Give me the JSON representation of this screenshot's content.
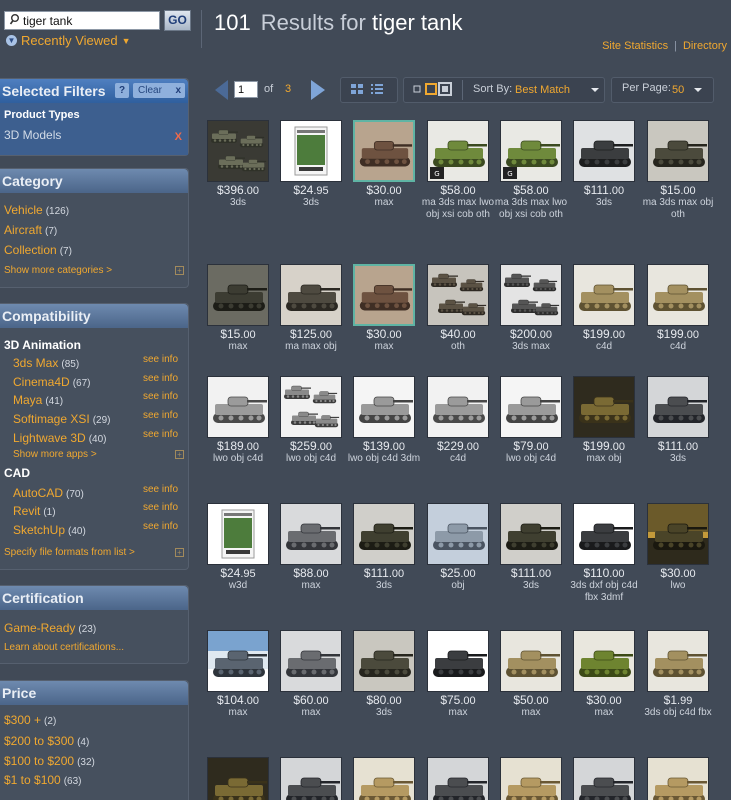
{
  "search": {
    "value": "tiger tank",
    "go_label": "GO"
  },
  "recently_viewed": "Recently Viewed",
  "header": {
    "count": "101",
    "results_for": "Results for",
    "query": "tiger tank"
  },
  "toplinks": {
    "site_statistics": "Site Statistics",
    "separator": "|",
    "directory": "Directory"
  },
  "selected_filters": {
    "title": "Selected Filters",
    "help": "?",
    "clear": "Clear",
    "clear_x": "x",
    "label": "Product Types",
    "value": "3D Models",
    "remove": "X"
  },
  "category": {
    "title": "Category",
    "items": [
      {
        "label": "Vehicle",
        "count": "(126)"
      },
      {
        "label": "Aircraft",
        "count": "(7)"
      },
      {
        "label": "Collection",
        "count": "(7)"
      }
    ],
    "more": "Show more categories >",
    "expand": "+"
  },
  "compatibility": {
    "title": "Compatibility",
    "groups": [
      {
        "name": "3D Animation",
        "apps": [
          {
            "label": "3ds Max",
            "count": "(85)",
            "info": "see info"
          },
          {
            "label": "Cinema4D",
            "count": "(67)",
            "info": "see info"
          },
          {
            "label": "Maya",
            "count": "(41)",
            "info": "see info"
          },
          {
            "label": "Softimage XSI",
            "count": "(29)",
            "info": "see info"
          },
          {
            "label": "Lightwave 3D",
            "count": "(40)",
            "info": "see info"
          }
        ],
        "more": "Show more apps >"
      },
      {
        "name": "CAD",
        "apps": [
          {
            "label": "AutoCAD",
            "count": "(70)",
            "info": "see info"
          },
          {
            "label": "Revit",
            "count": "(1)",
            "info": "see info"
          },
          {
            "label": "SketchUp",
            "count": "(40)",
            "info": "see info"
          }
        ]
      }
    ],
    "specify": "Specify file formats from list >"
  },
  "certification": {
    "title": "Certification",
    "item": {
      "label": "Game-Ready",
      "count": "(23)"
    },
    "learn": "Learn about certifications..."
  },
  "price_filter": {
    "title": "Price",
    "items": [
      {
        "label": "$300 +",
        "count": "(2)"
      },
      {
        "label": "$200 to $300",
        "count": "(4)"
      },
      {
        "label": "$100 to $200",
        "count": "(32)"
      },
      {
        "label": "$1 to $100",
        "count": "(63)"
      }
    ]
  },
  "toolbar": {
    "page": "1",
    "of": "of",
    "total_pages": "3",
    "sort_label": "Sort By:",
    "sort_value": "Best Match",
    "per_page_label": "Per Page:",
    "per_page_value": "50"
  },
  "colors": {
    "accent": "#f0a830",
    "background": "#414a57",
    "panel_header": "#4b6589",
    "selected_header": "#2f5f9e"
  },
  "products": [
    {
      "dollars": "$396",
      "cents": ".00",
      "formats": "3ds",
      "thumb": "tank-collection"
    },
    {
      "dollars": "$24",
      "cents": ".95",
      "formats": "3ds",
      "thumb": "product-box"
    },
    {
      "dollars": "$30",
      "cents": ".00",
      "formats": "max",
      "thumb": "tank-sepia"
    },
    {
      "dollars": "$58",
      "cents": ".00",
      "formats": "ma 3ds max lwo obj xsi cob oth",
      "thumb": "tank-camo-gameready"
    },
    {
      "dollars": "$58",
      "cents": ".00",
      "formats": "ma 3ds max lwo obj xsi cob oth",
      "thumb": "tank-camo-gameready"
    },
    {
      "dollars": "$111",
      "cents": ".00",
      "formats": "3ds",
      "thumb": "halftrack-gray"
    },
    {
      "dollars": "$15",
      "cents": ".00",
      "formats": "ma 3ds max obj oth",
      "thumb": "tank-dark"
    },
    {
      "dollars": "$15",
      "cents": ".00",
      "formats": "max",
      "thumb": "tank-night"
    },
    {
      "dollars": "$125",
      "cents": ".00",
      "formats": "ma max obj",
      "thumb": "tank-tiger"
    },
    {
      "dollars": "$30",
      "cents": ".00",
      "formats": "max",
      "thumb": "tank-sepia"
    },
    {
      "dollars": "$40",
      "cents": ".00",
      "formats": "oth",
      "thumb": "tank-small-group"
    },
    {
      "dollars": "$200",
      "cents": ".00",
      "formats": "3ds max",
      "thumb": "tank-parts"
    },
    {
      "dollars": "$199",
      "cents": ".00",
      "formats": "c4d",
      "thumb": "tank-tan"
    },
    {
      "dollars": "$199",
      "cents": ".00",
      "formats": "c4d",
      "thumb": "tank-tan"
    },
    {
      "dollars": "$189",
      "cents": ".00",
      "formats": "lwo obj c4d",
      "thumb": "spg-white"
    },
    {
      "dollars": "$259",
      "cents": ".00",
      "formats": "lwo obj c4d",
      "thumb": "tank-white-pair"
    },
    {
      "dollars": "$139",
      "cents": ".00",
      "formats": "lwo obj c4d 3dm",
      "thumb": "tank-white"
    },
    {
      "dollars": "$229",
      "cents": ".00",
      "formats": "c4d",
      "thumb": "spg-white"
    },
    {
      "dollars": "$79",
      "cents": ".00",
      "formats": "lwo obj c4d",
      "thumb": "tank-white"
    },
    {
      "dollars": "$199",
      "cents": ".00",
      "formats": "max obj",
      "thumb": "tank-tiger-dark"
    },
    {
      "dollars": "$111",
      "cents": ".00",
      "formats": "3ds",
      "thumb": "tank-gray"
    },
    {
      "dollars": "$24",
      "cents": ".95",
      "formats": "w3d",
      "thumb": "product-box"
    },
    {
      "dollars": "$88",
      "cents": ".00",
      "formats": "max",
      "thumb": "tank-gray-light"
    },
    {
      "dollars": "$111",
      "cents": ".00",
      "formats": "3ds",
      "thumb": "tank-olive"
    },
    {
      "dollars": "$25",
      "cents": ".00",
      "formats": "obj",
      "thumb": "tank-blue"
    },
    {
      "dollars": "$111",
      "cents": ".00",
      "formats": "3ds",
      "thumb": "tank-olive"
    },
    {
      "dollars": "$110",
      "cents": ".00",
      "formats": "3ds dxf obj c4d fbx 3dmf",
      "thumb": "tank-white-bg"
    },
    {
      "dollars": "$30",
      "cents": ".00",
      "formats": "lwo",
      "thumb": "tank-sunset"
    },
    {
      "dollars": "$104",
      "cents": ".00",
      "formats": "max",
      "thumb": "tank-winter"
    },
    {
      "dollars": "$60",
      "cents": ".00",
      "formats": "max",
      "thumb": "tank-gray-light"
    },
    {
      "dollars": "$80",
      "cents": ".00",
      "formats": "3ds",
      "thumb": "tank-dark"
    },
    {
      "dollars": "$75",
      "cents": ".00",
      "formats": "max",
      "thumb": "tank-white-bg"
    },
    {
      "dollars": "$50",
      "cents": ".00",
      "formats": "max",
      "thumb": "tank-tan"
    },
    {
      "dollars": "$30",
      "cents": ".00",
      "formats": "max",
      "thumb": "tank-green"
    },
    {
      "dollars": "$1",
      "cents": ".99",
      "formats": "3ds obj c4d fbx",
      "thumb": "tank-tan"
    },
    {
      "dollars": "",
      "cents": "",
      "formats": "",
      "thumb": "tank-tiger-dark"
    },
    {
      "dollars": "",
      "cents": "",
      "formats": "",
      "thumb": "tank-gray"
    },
    {
      "dollars": "",
      "cents": "",
      "formats": "",
      "thumb": "tank-sand"
    },
    {
      "dollars": "",
      "cents": "",
      "formats": "",
      "thumb": "tank-gray"
    },
    {
      "dollars": "",
      "cents": "",
      "formats": "",
      "thumb": "tank-sand"
    },
    {
      "dollars": "",
      "cents": "",
      "formats": "",
      "thumb": "tank-gray"
    },
    {
      "dollars": "",
      "cents": "",
      "formats": "",
      "thumb": "tank-sand"
    }
  ]
}
